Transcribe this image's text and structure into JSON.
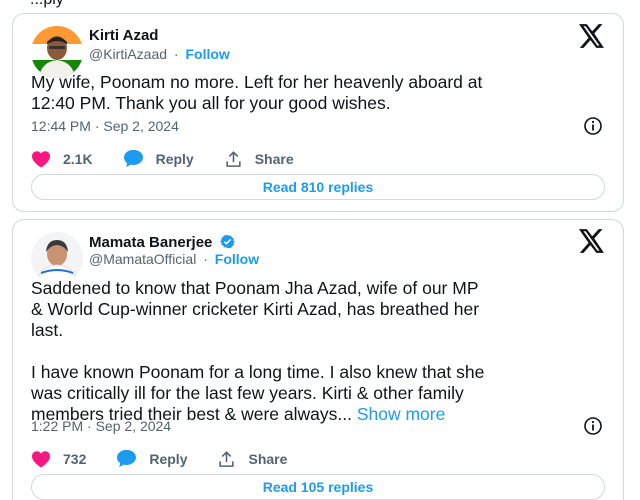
{
  "header_partial": "...ply",
  "tweets": [
    {
      "name": "Kirti Azad",
      "handle": "@KirtiAzaad",
      "separator": "·",
      "follow_label": "Follow",
      "verified": false,
      "text": "My wife, Poonam no more. Left for her heavenly aboard at\n12:40 PM. Thank you all for your good wishes.",
      "show_more": "",
      "timestamp": "12:44 PM · Sep 2, 2024",
      "likes": "2.1K",
      "reply_label": "Reply",
      "share_label": "Share",
      "read_replies": "Read 810 replies"
    },
    {
      "name": "Mamata Banerjee",
      "handle": "@MamataOfficial",
      "separator": "·",
      "follow_label": "Follow",
      "verified": true,
      "text": "Saddened to know that Poonam Jha Azad, wife of our MP\n& World Cup-winner cricketer Kirti Azad, has breathed her\nlast.\n\nI have known Poonam for a long time. I also knew that she\nwas critically ill for the last few years. Kirti & other family\nmembers tried their best & were always... ",
      "show_more": "Show more",
      "timestamp": "1:22 PM · Sep 2, 2024",
      "likes": "732",
      "reply_label": "Reply",
      "share_label": "Share",
      "read_replies": "Read 105 replies"
    }
  ],
  "colors": {
    "accent": "#1d9bf0",
    "heart": "#f91880",
    "secondary_text": "#536471",
    "border": "#cfd9de"
  },
  "icons": [
    "x-logo-icon",
    "info-icon",
    "heart-icon",
    "reply-bubble-icon",
    "share-icon",
    "verified-badge-icon"
  ]
}
